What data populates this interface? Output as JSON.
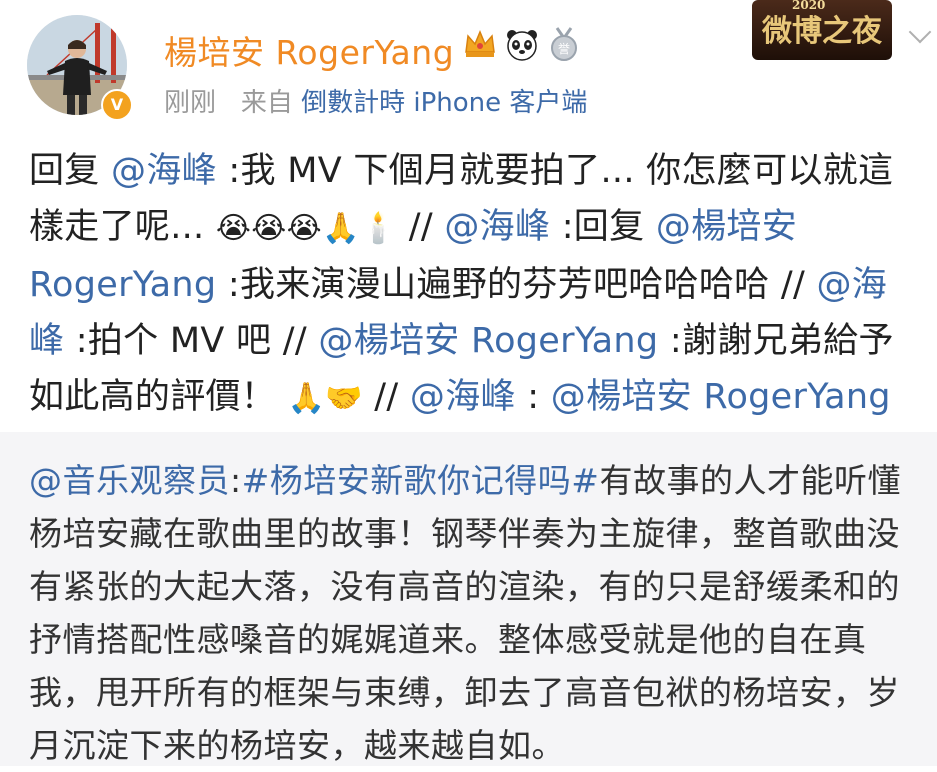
{
  "header": {
    "username": "楊培安 RogerYang",
    "verified_mark": "V",
    "badges": [
      "crown-icon",
      "panda-icon",
      "medal-icon"
    ],
    "time": "刚刚",
    "from_prefix": "来自",
    "source": "倒數計時 iPhone 客户端",
    "event_badge_text": "微博之夜",
    "event_year": "2020"
  },
  "post": {
    "seg1": "回复",
    "m1": "@海峰",
    "seg2": ":我 MV 下個月就要拍了...  你怎麼可以就這樣走了呢...",
    "emojis1": "😭😭😭🙏🕯️",
    "seg3": " //",
    "m2": "@海峰",
    "seg4": ":回复 ",
    "m3": "@楊培安 RogerYang",
    "seg5": ":我来演漫山遍野的芬芳吧哈哈哈哈 //",
    "m4": "@海峰",
    "seg6": ":拍个 MV 吧 //",
    "m5": "@楊培安 RogerYang",
    "seg7": ":謝謝兄弟給予如此高的評價！ ",
    "emojis2": "🙏🤝",
    "seg8": "//",
    "m6": "@海峰",
    "seg9": ":",
    "m7": "@楊培安 RogerYang"
  },
  "quote": {
    "mention": "@音乐观察员",
    "colon": ":",
    "hashtag": "#杨培安新歌你记得吗#",
    "body": "有故事的人才能听懂杨培安藏在歌曲里的故事！钢琴伴奏为主旋律，整首歌曲没有紧张的大起大落，没有高音的渲染，有的只是舒缓柔和的抒情搭配性感嗓音的娓娓道来。整体感受就是他的自在真我，甩开所有的框架与束缚，卸去了高音包袱的杨培安，岁月沉淀下来的杨培安，越来越自如。"
  },
  "colors": {
    "username": "#f08a24",
    "link": "#3d6aa8",
    "meta": "#9a9a9a",
    "quote_bg": "#f5f5f7"
  }
}
